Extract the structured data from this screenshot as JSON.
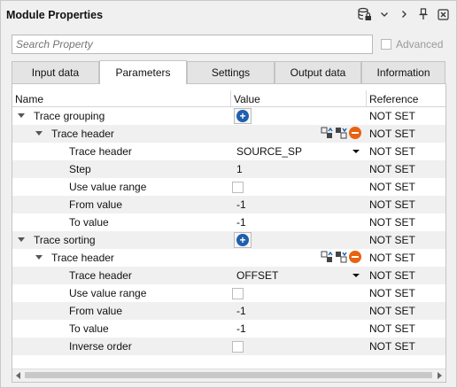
{
  "title": "Module Properties",
  "toolbar_icons": [
    "database-lock-icon",
    "chevron-down-icon",
    "chevron-right-icon",
    "pin-icon",
    "close-icon"
  ],
  "search": {
    "placeholder": "Search Property"
  },
  "advanced": {
    "label": "Advanced",
    "checked": false
  },
  "tabs": [
    {
      "label": "Input data",
      "active": false
    },
    {
      "label": "Parameters",
      "active": true
    },
    {
      "label": "Settings",
      "active": false
    },
    {
      "label": "Output data",
      "active": false
    },
    {
      "label": "Information",
      "active": false
    }
  ],
  "columns": {
    "name": "Name",
    "value": "Value",
    "reference": "Reference"
  },
  "rows": [
    {
      "name": "Trace grouping",
      "level": 0,
      "expander": true,
      "value_type": "add",
      "reference": "NOT SET"
    },
    {
      "name": "Trace header",
      "level": 1,
      "expander": true,
      "value_type": "actions",
      "reference": "NOT SET"
    },
    {
      "name": "Trace header",
      "level": 2,
      "value_type": "dropdown",
      "value": "SOURCE_SP",
      "reference": "NOT SET"
    },
    {
      "name": "Step",
      "level": 2,
      "value_type": "text",
      "value": "1",
      "reference": "NOT SET"
    },
    {
      "name": "Use value range",
      "level": 2,
      "value_type": "checkbox",
      "reference": "NOT SET"
    },
    {
      "name": "From value",
      "level": 2,
      "value_type": "text",
      "value": "-1",
      "reference": "NOT SET"
    },
    {
      "name": "To value",
      "level": 2,
      "value_type": "text",
      "value": "-1",
      "reference": "NOT SET"
    },
    {
      "name": "Trace sorting",
      "level": 0,
      "expander": true,
      "value_type": "add",
      "reference": "NOT SET"
    },
    {
      "name": "Trace header",
      "level": 1,
      "expander": true,
      "value_type": "actions",
      "reference": "NOT SET"
    },
    {
      "name": "Trace header",
      "level": 2,
      "value_type": "dropdown",
      "value": "OFFSET",
      "reference": "NOT SET"
    },
    {
      "name": "Use value range",
      "level": 2,
      "value_type": "checkbox",
      "reference": "NOT SET"
    },
    {
      "name": "From value",
      "level": 2,
      "value_type": "text",
      "value": "-1",
      "reference": "NOT SET"
    },
    {
      "name": "To value",
      "level": 2,
      "value_type": "text",
      "value": "-1",
      "reference": "NOT SET"
    },
    {
      "name": "Inverse order",
      "level": 2,
      "value_type": "checkbox",
      "reference": "NOT SET"
    }
  ],
  "colors": {
    "accent": "#1f5fae",
    "remove": "#e8620f",
    "alt_row": "#f0f0f0"
  }
}
